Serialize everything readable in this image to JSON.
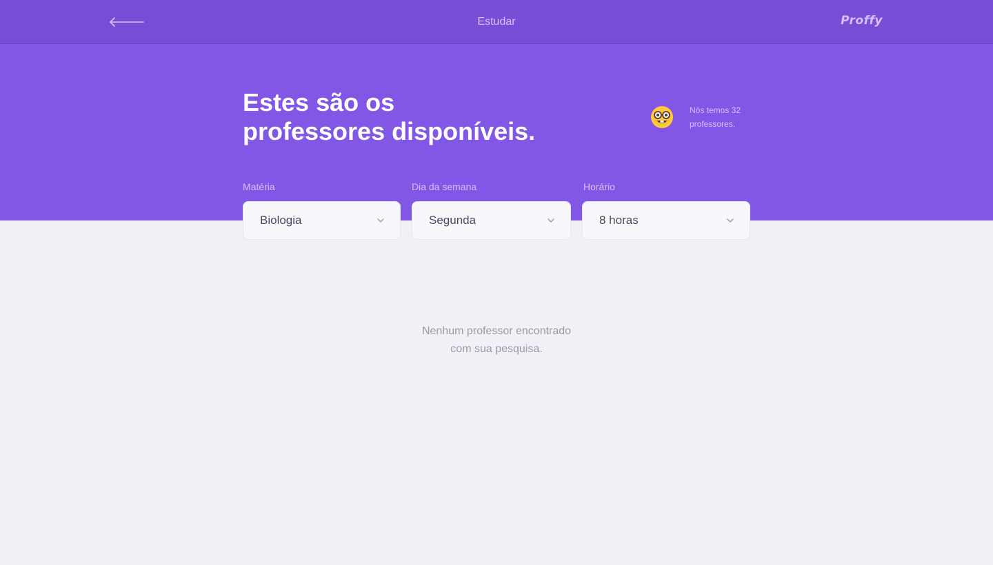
{
  "topbar": {
    "back_icon": "arrow-left-icon",
    "title": "Estudar",
    "brand": "Proffy"
  },
  "hero": {
    "title_line1": "Estes são os",
    "title_line2": "professores disponíveis.",
    "emoji_icon": "nerd-face-icon",
    "count_line1": "Nós temos 32",
    "count_line2": "professores."
  },
  "filters": {
    "subject": {
      "label": "Matéria",
      "value": "Biologia",
      "icon": "chevron-down-icon"
    },
    "weekday": {
      "label": "Dia da semana",
      "value": "Segunda",
      "icon": "chevron-down-icon"
    },
    "time": {
      "label": "Horário",
      "value": "8 horas",
      "icon": "chevron-down-icon"
    }
  },
  "results": {
    "empty_line1": "Nenhum professor encontrado",
    "empty_line2": "com sua pesquisa."
  },
  "colors": {
    "topbar": "#774DD6",
    "hero": "#8257E5",
    "background": "#F0F0F7",
    "muted_text": "#D4C2FF"
  }
}
